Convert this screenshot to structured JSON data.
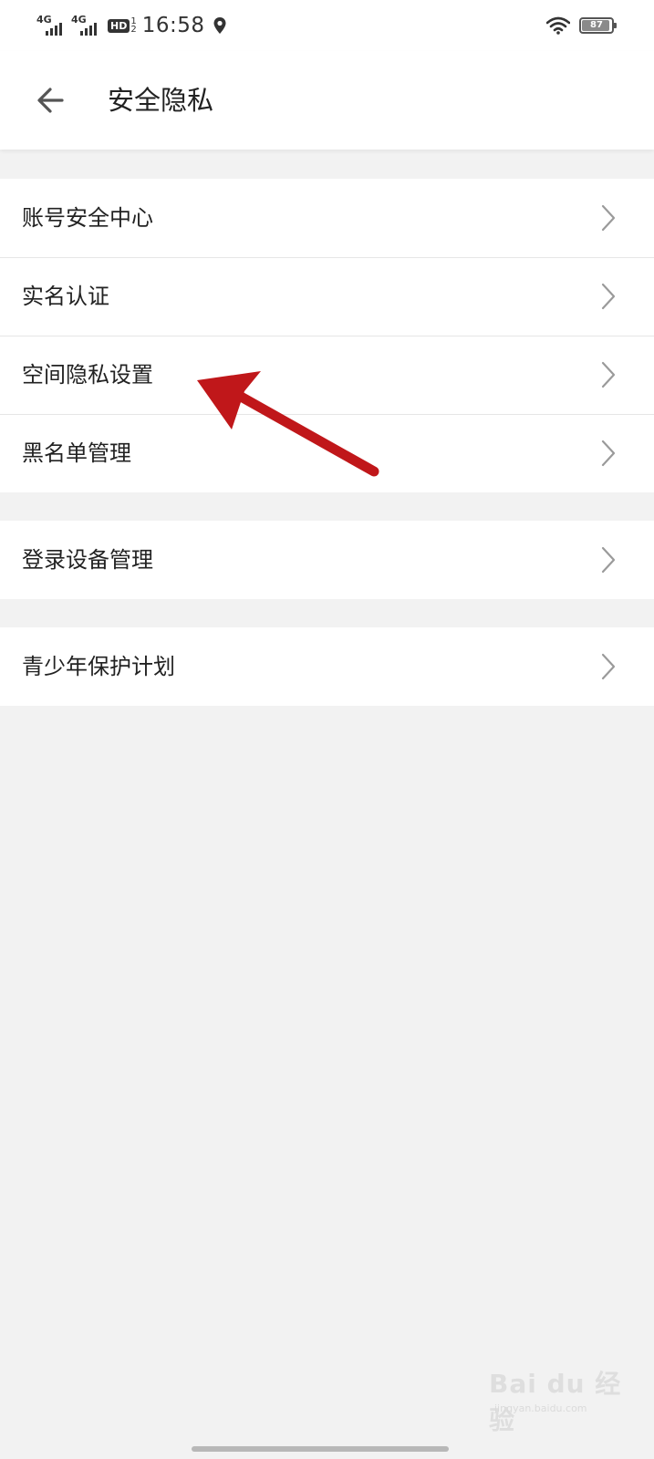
{
  "status_bar": {
    "sim1_label": "4G",
    "sim2_label": "4G",
    "hd_label": "HD",
    "hd_sub_top": "1",
    "hd_sub_bottom": "2",
    "time": "16:58",
    "battery_level": "87"
  },
  "header": {
    "title": "安全隐私",
    "back_icon": "arrow-left-icon"
  },
  "groups": [
    {
      "items": [
        {
          "label": "账号安全中心",
          "icon": "chevron-right-icon"
        },
        {
          "label": "实名认证",
          "icon": "chevron-right-icon"
        },
        {
          "label": "空间隐私设置",
          "icon": "chevron-right-icon"
        },
        {
          "label": "黑名单管理",
          "icon": "chevron-right-icon"
        }
      ]
    },
    {
      "items": [
        {
          "label": "登录设备管理",
          "icon": "chevron-right-icon"
        }
      ]
    },
    {
      "items": [
        {
          "label": "青少年保护计划",
          "icon": "chevron-right-icon"
        }
      ]
    }
  ],
  "annotation": {
    "arrow_color": "#c0171a"
  },
  "watermark": {
    "logo": "Bai du 经验",
    "sub": "jingyan.baidu.com"
  },
  "colors": {
    "page_bg": "#f2f2f2",
    "surface": "#ffffff",
    "divider": "#e6e6e6",
    "text_primary": "#222222",
    "chevron": "#9a9a9a"
  }
}
